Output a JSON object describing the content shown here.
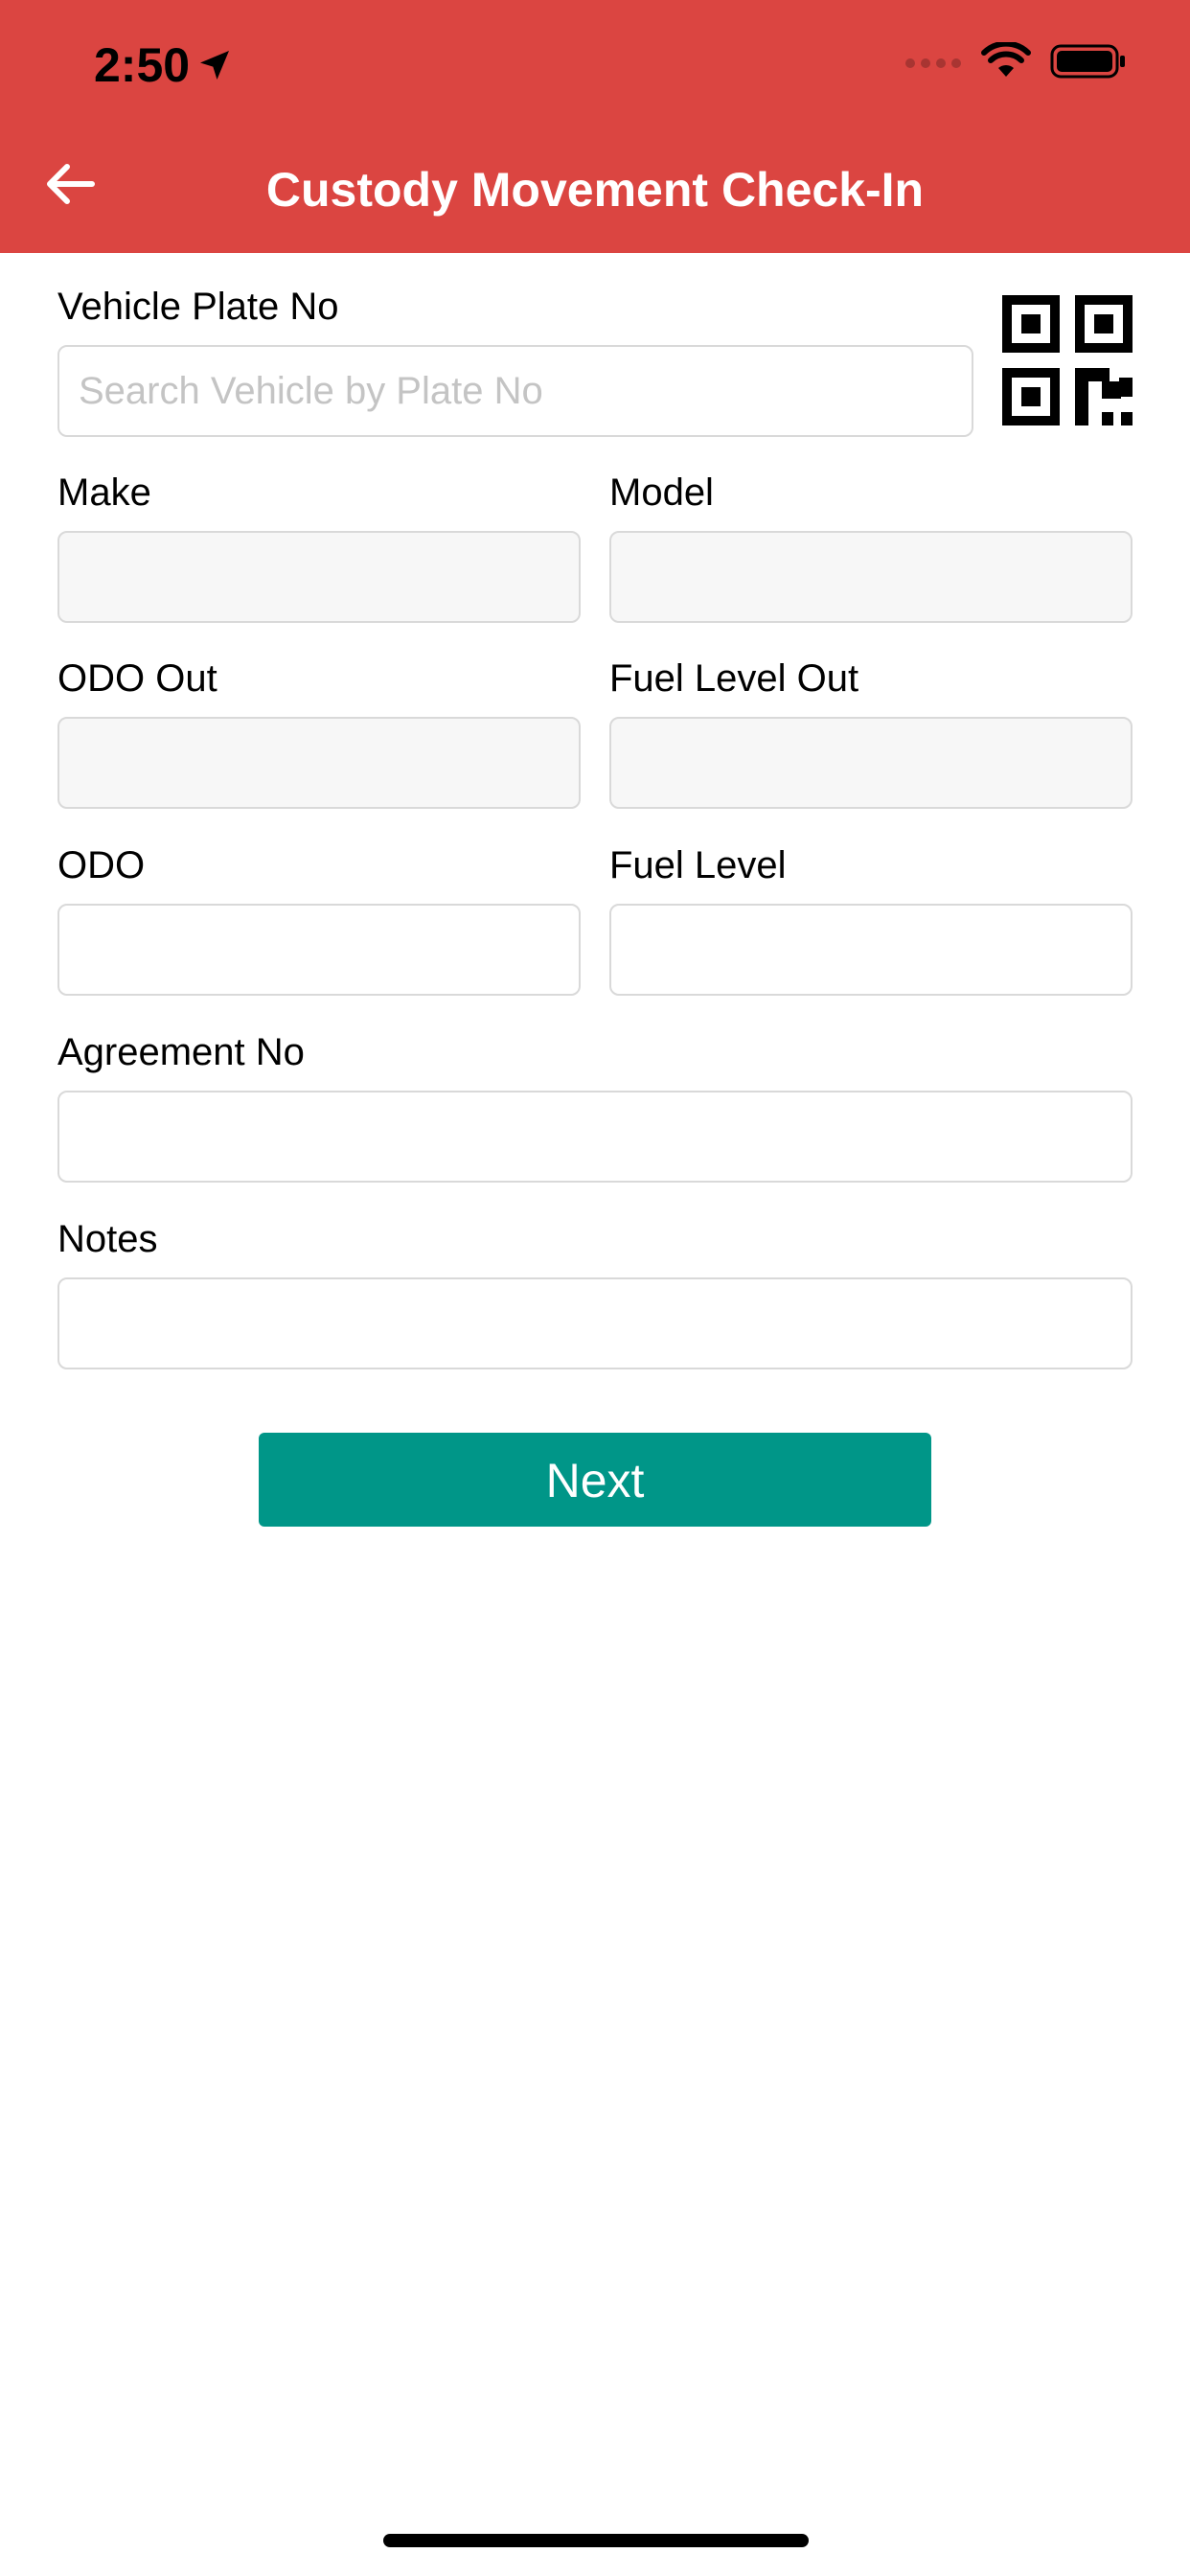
{
  "status_bar": {
    "time": "2:50",
    "icons": [
      "location-arrow-icon",
      "signal-icon",
      "wifi-icon",
      "battery-icon"
    ]
  },
  "header": {
    "title": "Custody Movement Check-In",
    "back_icon": "arrow-left-icon",
    "background": "#db4541"
  },
  "form": {
    "vehicle_plate": {
      "label": "Vehicle Plate No",
      "value": "",
      "placeholder": "Search Vehicle by Plate No",
      "scan_icon": "qr-code-icon"
    },
    "make": {
      "label": "Make",
      "value": ""
    },
    "model": {
      "label": "Model",
      "value": ""
    },
    "odo_out": {
      "label": "ODO Out",
      "value": ""
    },
    "fuel_level_out": {
      "label": "Fuel Level Out",
      "value": ""
    },
    "odo": {
      "label": "ODO",
      "value": ""
    },
    "fuel_level": {
      "label": "Fuel Level",
      "value": ""
    },
    "agreement_no": {
      "label": "Agreement No",
      "value": ""
    },
    "notes": {
      "label": "Notes",
      "value": ""
    }
  },
  "actions": {
    "next_label": "Next",
    "accent": "#009688"
  }
}
